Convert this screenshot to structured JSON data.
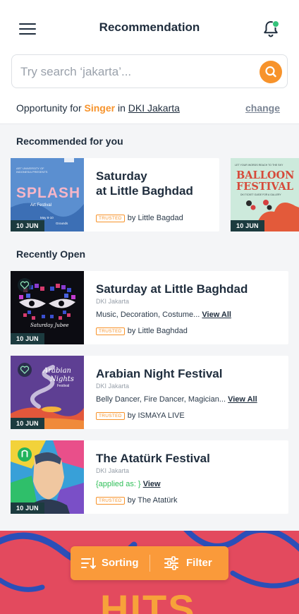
{
  "header": {
    "title": "Recommendation",
    "menu_icon": "hamburger-menu-icon",
    "notification_icon": "bell-icon",
    "notification_dot_color": "#35c27a"
  },
  "search": {
    "placeholder": "Try search ‘jakarta’...",
    "button_icon": "search-icon",
    "accent": "#f7932b"
  },
  "opportunity": {
    "prefix": "Opportunity for",
    "role": "Singer",
    "connector": "in",
    "location": "DKI Jakarta",
    "change_label": "change"
  },
  "recommended": {
    "section_title": "Recommended for you",
    "items": [
      {
        "title_line1": "Saturday",
        "title_line2": "at Little Baghdad",
        "trusted_label": "TRUSTED",
        "organizer": "by Little Bagdad",
        "date": "10 JUN",
        "poster_kicker": "ART UNIVERSITY OF INDONESIA PRESENTS",
        "poster_title": "SPLASH",
        "poster_sub": "Art Festival",
        "poster_meta": "May 8-10",
        "poster_meta2": "Grounds"
      },
      {
        "date": "10 JUN",
        "poster_kicker": "LET YOUR WORDS REACH TO THE SKY",
        "poster_title_line1": "BALLOON",
        "poster_title_line2": "FESTIVAL",
        "poster_sub": "DKI TICKET GUIDE FOR A GALLERY"
      }
    ]
  },
  "recent": {
    "section_title": "Recently Open",
    "items": [
      {
        "title": "Saturday at Little Baghdad",
        "location": "DKI Jakarta",
        "roles": "Music, Decoration, Costume...",
        "view_label": "View All",
        "trusted_label": "TRUSTED",
        "organizer": "by Little Baghdad",
        "date": "10 JUN",
        "poster_script": "Saturday Jubee"
      },
      {
        "title": "Arabian Night Festival",
        "location": "DKI Jakarta",
        "roles": "Belly Dancer, Fire Dancer, Magician...",
        "view_label": "View All",
        "trusted_label": "TRUSTED",
        "organizer": "by ISMAYA LIVE",
        "date": "10 JUN",
        "poster_line1": "Arabian",
        "poster_line2": "Nights",
        "poster_line3": "Festival"
      },
      {
        "title": "The Atatürk Festival",
        "location": "DKI Jakarta",
        "applied_label": "{applied as: }",
        "view_label": "View",
        "trusted_label": "TRUSTED",
        "organizer": "by The Atatürk",
        "date": "10 JUN"
      }
    ]
  },
  "bottom_bar": {
    "sorting_label": "Sorting",
    "filter_label": "Filter",
    "sorting_icon": "sort-icon",
    "filter_icon": "sliders-icon",
    "banner_text": "HITS"
  }
}
